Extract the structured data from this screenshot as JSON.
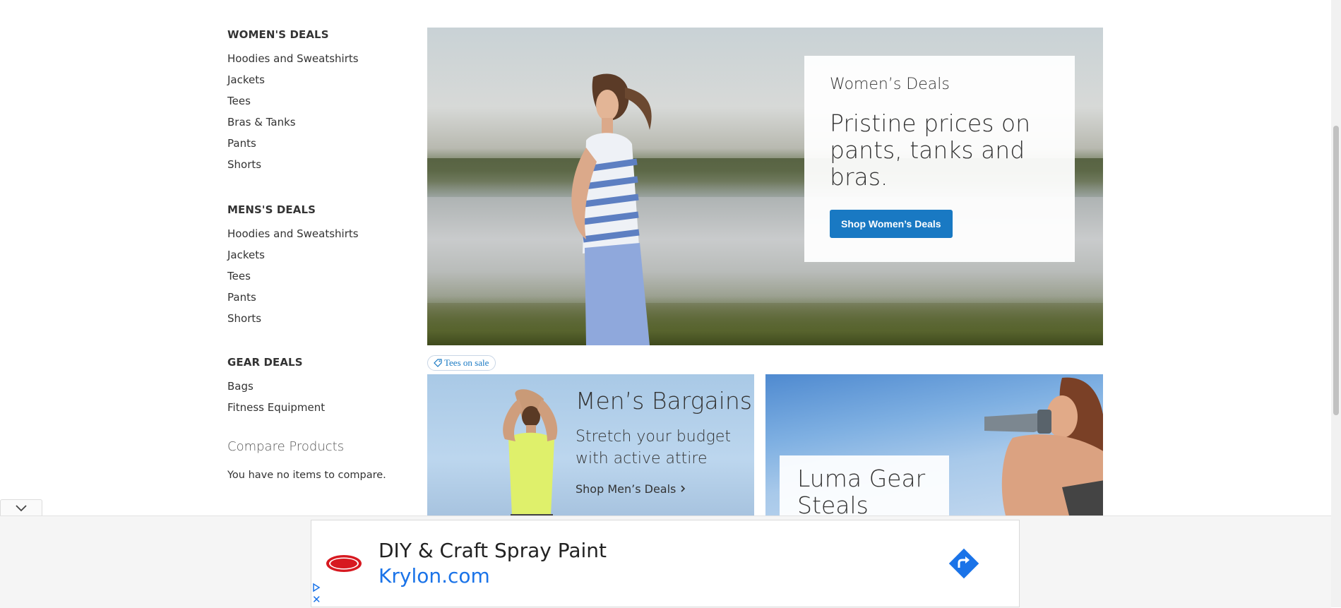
{
  "sidebar": {
    "groups": [
      {
        "title": "WOMEN'S DEALS",
        "items": [
          "Hoodies and Sweatshirts",
          "Jackets",
          "Tees",
          "Bras & Tanks",
          "Pants",
          "Shorts"
        ]
      },
      {
        "title": "MENS'S DEALS",
        "items": [
          "Hoodies and Sweatshirts",
          "Jackets",
          "Tees",
          "Pants",
          "Shorts"
        ]
      },
      {
        "title": "GEAR DEALS",
        "items": [
          "Bags",
          "Fitness Equipment"
        ]
      }
    ],
    "compare": {
      "title": "Compare Products",
      "empty_text": "You have no items to compare."
    }
  },
  "hero": {
    "eyebrow": "Women’s Deals",
    "headline": "Pristine prices on pants, tanks and bras.",
    "cta_label": "Shop Women’s Deals"
  },
  "tag": {
    "label": "Tees on sale",
    "color": "#1979c3"
  },
  "mens_promo": {
    "title": "Men’s Bargains",
    "subtitle": "Stretch your budget with active attire",
    "link_label": "Shop Men’s Deals",
    "link_icon": "chevron-right-icon"
  },
  "gear_promo": {
    "title": "Luma Gear Steals"
  },
  "ad": {
    "brand_logo": "KRYLON",
    "headline": "DIY & Craft Spray Paint",
    "url": "Krylon.com",
    "go_icon": "arrow-turn-right-icon",
    "accent": "#1a73e8",
    "adchoices_icon": "adchoices-triangle-icon",
    "close_icon": "close-icon",
    "close_label": "✕"
  },
  "colors": {
    "primary_button": "#1979c3",
    "text": "#333333"
  }
}
